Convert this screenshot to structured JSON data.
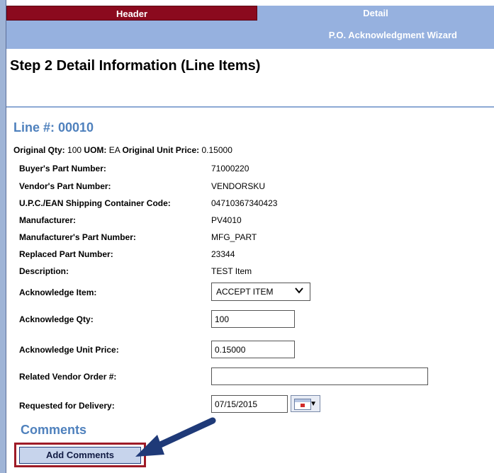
{
  "tabs": {
    "header": "Header",
    "detail": "Detail"
  },
  "wizard_title": "P.O. Acknowledgment Wizard",
  "step_title": "Step 2 Detail Information (Line Items)",
  "line_number": "Line #: 00010",
  "original": {
    "qty_label": "Original Qty:",
    "qty_value": "100",
    "uom_label": "UOM:",
    "uom_value": "EA",
    "price_label": "Original Unit Price:",
    "price_value": "0.15000"
  },
  "fields": [
    {
      "label": "Buyer's Part Number:",
      "value": "71000220"
    },
    {
      "label": "Vendor's Part Number:",
      "value": "VENDORSKU"
    },
    {
      "label": "U.P.C./EAN Shipping Container Code:",
      "value": "04710367340423"
    },
    {
      "label": "Manufacturer:",
      "value": "PV4010"
    },
    {
      "label": "Manufacturer's Part Number:",
      "value": "MFG_PART"
    },
    {
      "label": "Replaced Part Number:",
      "value": "23344"
    },
    {
      "label": "Description:",
      "value": "TEST Item"
    }
  ],
  "form": {
    "ack_item_label": "Acknowledge Item:",
    "ack_item_value": "ACCEPT ITEM",
    "ack_qty_label": "Acknowledge Qty:",
    "ack_qty_value": "100",
    "ack_price_label": "Acknowledge Unit Price:",
    "ack_price_value": "0.15000",
    "vendor_order_label": "Related Vendor Order #:",
    "vendor_order_value": "",
    "delivery_label": "Requested for Delivery:",
    "delivery_value": "07/15/2015"
  },
  "comments_title": "Comments",
  "add_comments_label": "Add Comments",
  "colors": {
    "header_tab": "#8b0a1e",
    "detail_bar": "#96b1df",
    "accent_blue": "#4f81bd",
    "highlight": "#9e1b27",
    "arrow": "#1f3a78"
  },
  "icons": {
    "dropdown": "chevron-down-icon",
    "calendar": "calendar-icon",
    "pointer": "arrow-pointer-icon"
  }
}
